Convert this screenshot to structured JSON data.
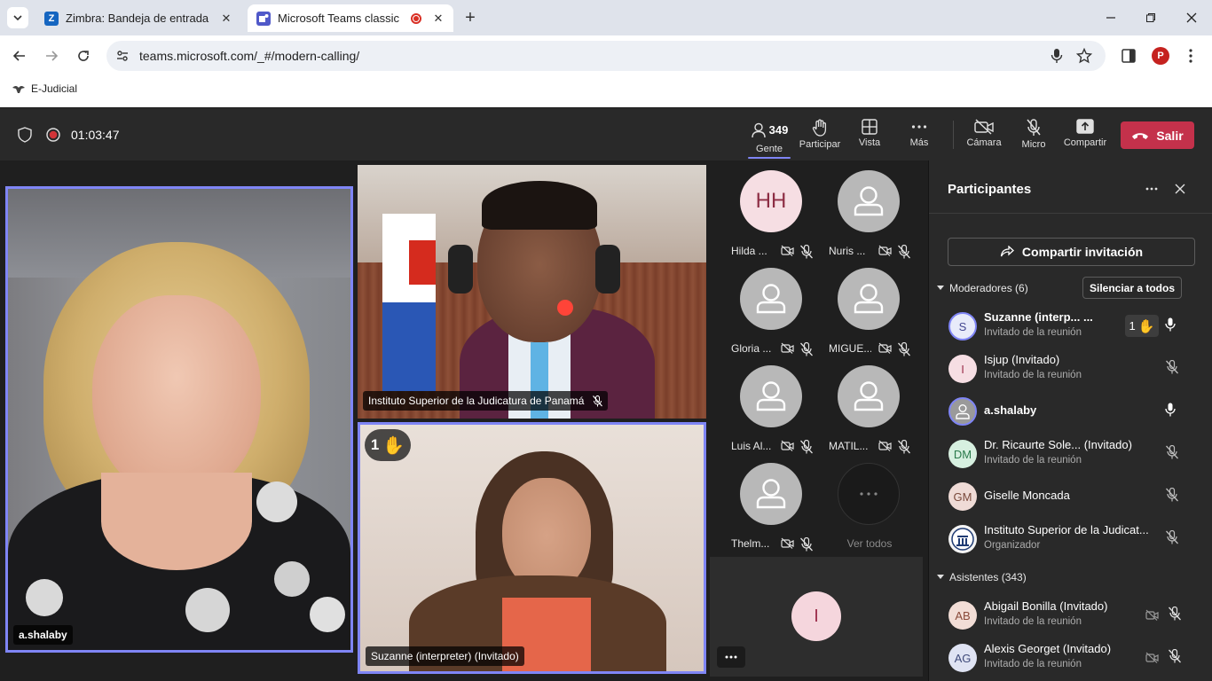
{
  "browser": {
    "tabs": [
      {
        "title": "Zimbra: Bandeja de entrada",
        "favicon_letter": "Z",
        "favicon_color": "#1565c0"
      },
      {
        "title": "Microsoft Teams classic",
        "favicon_color": "#5059c9"
      }
    ],
    "url": "teams.microsoft.com/_#/modern-calling/",
    "bookmark": "E-Judicial",
    "profile_letter": "P"
  },
  "meeting": {
    "timer": "01:03:47",
    "people_count": "349",
    "buttons": {
      "people": "Gente",
      "participate": "Participar",
      "view": "Vista",
      "more": "Más",
      "camera": "Cámara",
      "mic": "Micro",
      "share": "Compartir",
      "leave": "Salir"
    }
  },
  "stage": {
    "main_tile_name": "a.shalaby",
    "top_tile_name": "Instituto Superior de la Judicatura de Panamá",
    "bottom_tile_name": "Suzanne (interpreter) (Invitado)",
    "bottom_tile_hand_count": "1",
    "gallery": [
      {
        "name": "Hilda ...",
        "initials": "HH"
      },
      {
        "name": "Nuris ..."
      },
      {
        "name": "Gloria ..."
      },
      {
        "name": "MIGUE..."
      },
      {
        "name": "Luis Al..."
      },
      {
        "name": "MATIL..."
      },
      {
        "name": "Thelm..."
      }
    ],
    "see_all": "Ver todos",
    "self_initial": "I"
  },
  "panel": {
    "title": "Participantes",
    "share_invite": "Compartir invitación",
    "moderators_header": "Moderadores (6)",
    "mute_all": "Silenciar a todos",
    "attendees_header": "Asistentes (343)",
    "moderators": [
      {
        "initials": "S",
        "name": "Suzanne (interp... ...",
        "sub": "Invitado de la reunión",
        "hand": "1",
        "mic": "on"
      },
      {
        "initials": "I",
        "name": "Isjup (Invitado)",
        "sub": "Invitado de la reunión",
        "mic": "off"
      },
      {
        "initials": "",
        "name": "a.shalaby",
        "sub": "",
        "mic": "on"
      },
      {
        "initials": "DM",
        "name": "Dr. Ricaurte Sole... (Invitado)",
        "sub": "Invitado de la reunión",
        "mic": "off"
      },
      {
        "initials": "GM",
        "name": "Giselle Moncada",
        "sub": "",
        "mic": "off"
      },
      {
        "initials": "",
        "name": "Instituto Superior de la Judicat...",
        "sub": "Organizador",
        "mic": "off"
      }
    ],
    "attendees": [
      {
        "initials": "AB",
        "name": "Abigail Bonilla (Invitado)",
        "sub": "Invitado de la reunión"
      },
      {
        "initials": "AG",
        "name": "Alexis Georget (Invitado)",
        "sub": "Invitado de la reunión"
      }
    ]
  }
}
